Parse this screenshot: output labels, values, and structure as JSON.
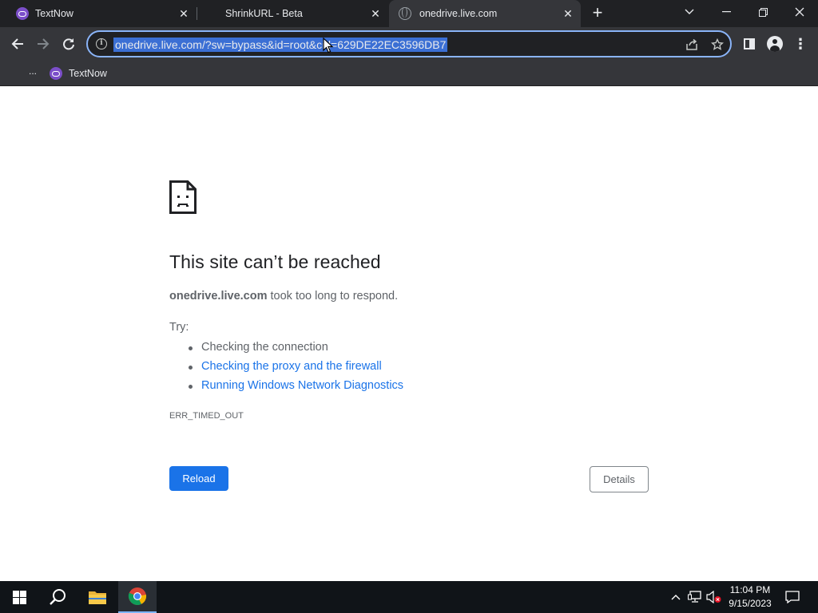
{
  "browser": {
    "tabs": [
      {
        "title": "TextNow",
        "icon": "textnow-logo",
        "active": false
      },
      {
        "title": "ShrinkURL - Beta",
        "icon": "none",
        "active": false
      },
      {
        "title": "onedrive.live.com",
        "icon": "globe-icon",
        "active": true
      }
    ],
    "address_bar": {
      "url": "onedrive.live.com/?sw=bypass&id=root&cid=629DE22EC3596DB7",
      "selected": true
    },
    "bookmarks": {
      "more_label": "...",
      "items": [
        {
          "label": "TextNow",
          "icon": "textnow-logo"
        }
      ]
    }
  },
  "page": {
    "title": "This site can’t be reached",
    "host": "onedrive.live.com",
    "message_suffix": " took too long to respond.",
    "try_label": "Try:",
    "suggestions": [
      {
        "text": "Checking the connection",
        "link": false
      },
      {
        "text": "Checking the proxy and the firewall",
        "link": true
      },
      {
        "text": "Running Windows Network Diagnostics",
        "link": true
      }
    ],
    "error_code": "ERR_TIMED_OUT",
    "reload_label": "Reload",
    "details_label": "Details"
  },
  "taskbar": {
    "time": "11:04 PM",
    "date": "9/15/2023",
    "pinned": [
      "windows-start",
      "search",
      "file-explorer",
      "chrome"
    ]
  },
  "colors": {
    "accent": "#1a73e8",
    "chrome_dark": "#202124",
    "toolbar": "#35363a",
    "link": "#1a73e8"
  }
}
